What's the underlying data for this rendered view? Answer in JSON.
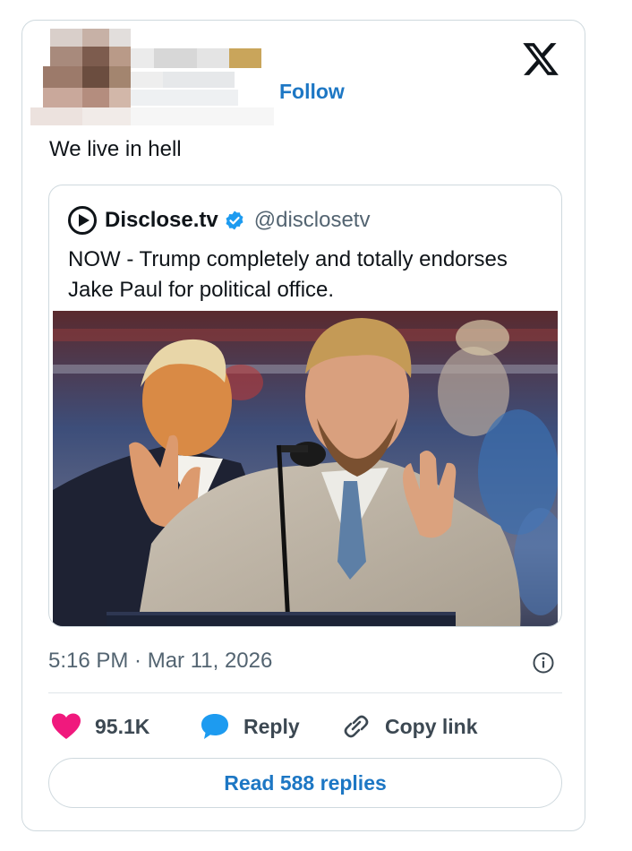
{
  "embed": {
    "follow_label": "Follow",
    "text": "We live in hell",
    "brand_icon": "x-logo-icon"
  },
  "quoted": {
    "name": "Disclose.tv",
    "handle": "@disclosetv",
    "verified": true,
    "text": "NOW - Trump completely and totally endorses Jake Paul for political office.",
    "avatar_icon": "play-circle-icon"
  },
  "meta": {
    "timestamp": "5:16 PM · Mar 11, 2026"
  },
  "actions": {
    "like_count": "95.1K",
    "reply_label": "Reply",
    "copy_label": "Copy link"
  },
  "read_replies_label": "Read 588 replies",
  "colors": {
    "accent": "#1d77c4",
    "like": "#f0197d",
    "reply_icon": "#1d9bf0",
    "verified": "#1d9bf0",
    "border": "#cfd9de",
    "muted": "#536471"
  }
}
